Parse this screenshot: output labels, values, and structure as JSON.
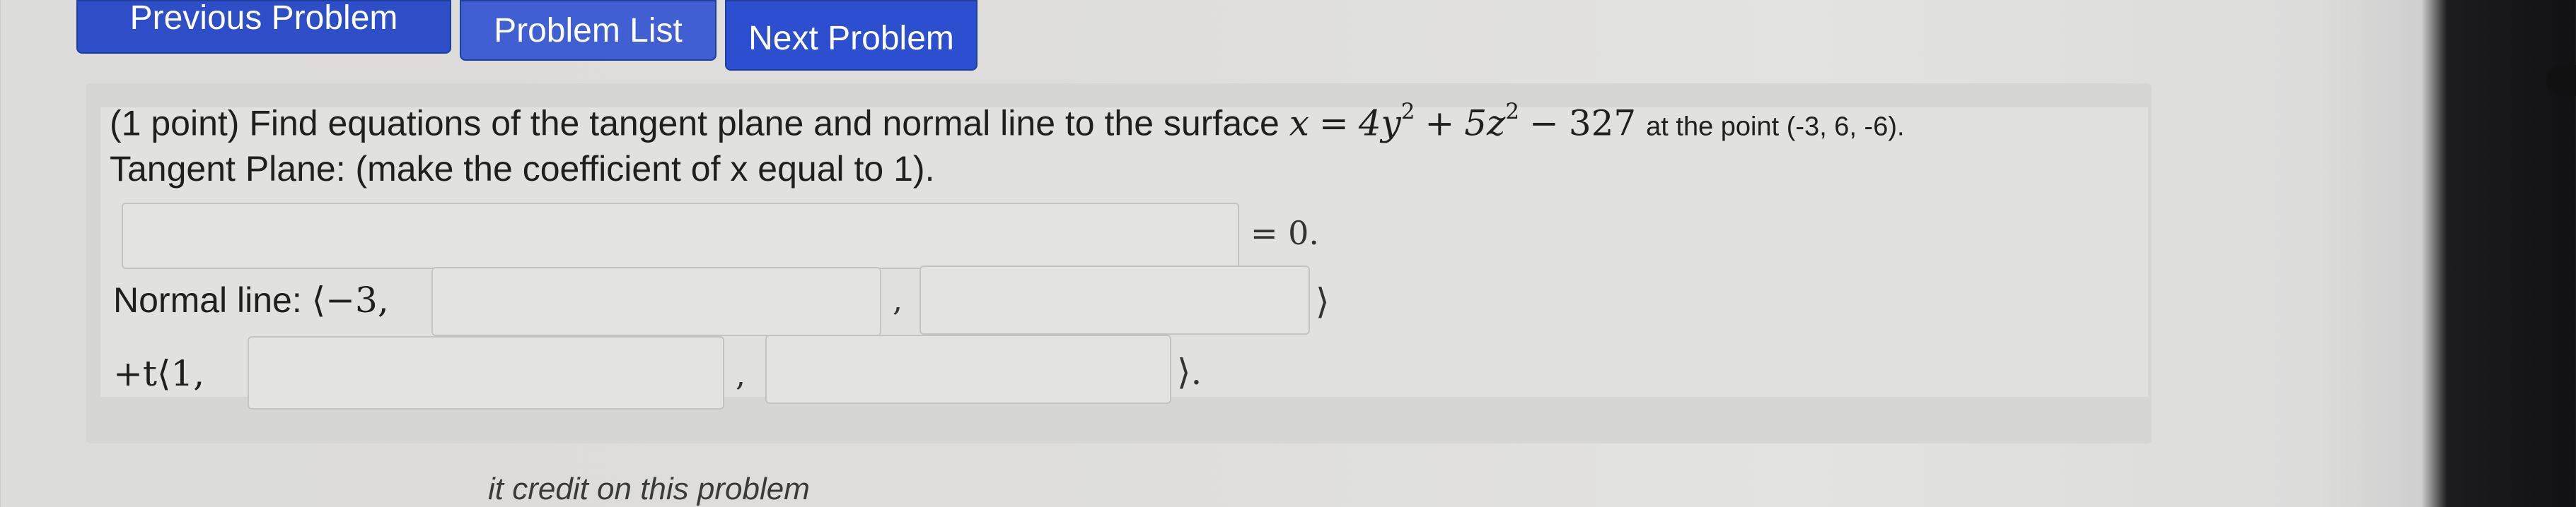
{
  "nav": {
    "previous_label": "Previous Problem",
    "list_label": "Problem List",
    "next_label": "Next Problem"
  },
  "problem": {
    "prefix": "(1 point) Find equations of the tangent plane and normal line to the surface",
    "eq_var": "x",
    "eq_rhs_a": "4y",
    "eq_rhs_b": "5z",
    "eq_rhs_c": "327",
    "point_text": "at the point (-3, 6, -6).",
    "tangent_label": "Tangent Plane: (make the coefficient of x equal to 1).",
    "tangent_rhs": "= 0.",
    "normal_label": "Normal line:",
    "normal_start": "⟨−3,",
    "param_start": "+t⟨1,",
    "comma": ",",
    "close_angle": "⟩",
    "close_angle_dot": "⟩."
  },
  "inputs": {
    "tangent_plane": "",
    "normal_y": "",
    "normal_z": "",
    "dir_y": "",
    "dir_z": ""
  },
  "footer": {
    "partial_text": "it credit on this problem"
  },
  "colors": {
    "nav_button": "#2e4ec8",
    "panel": "#d6d6d4",
    "inner": "#e1e1df"
  }
}
